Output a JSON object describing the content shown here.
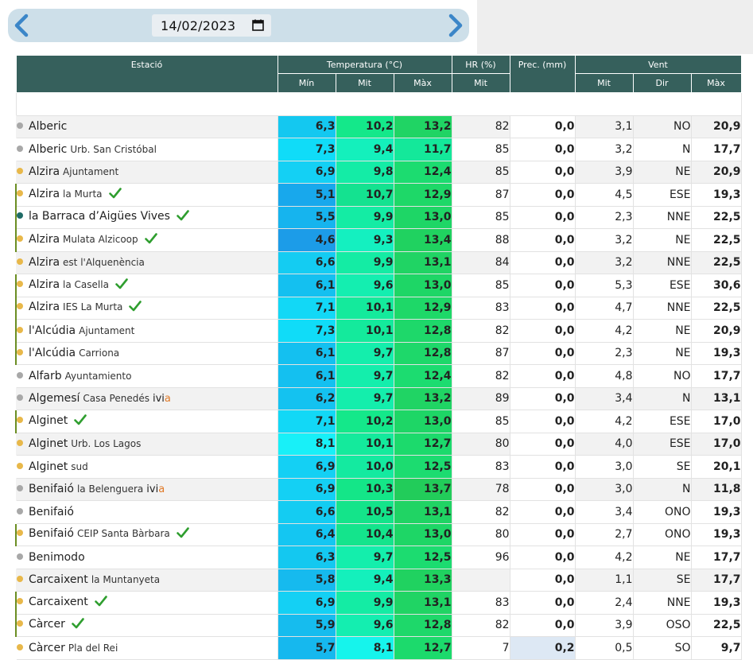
{
  "date": "14/02/2023",
  "colors": {
    "header_bg": "#36605c",
    "nav_bg": "#cddfe9",
    "arrow": "#3b86c8",
    "check": "#2f9e2f",
    "dot_colors": {
      "gray": "#a8a8a8",
      "yellow": "#e8b84a",
      "teal": "#1f6b66"
    },
    "left_bar": "#6b8e23"
  },
  "icons": {
    "prev": "chevron-left-icon",
    "next": "chevron-right-icon",
    "calendar": "calendar-icon",
    "check": "check-icon"
  },
  "headers": {
    "estacio": "Estació",
    "temperatura": "Temperatura (°C)",
    "hr": "HR (%)",
    "prec": "Prec. (mm)",
    "vent": "Vent",
    "min": "Mín",
    "mit": "Mit",
    "max": "Màx",
    "hr_mit": "Mit",
    "vent_mit": "Mit",
    "dir": "Dir",
    "vent_max": "Màx"
  },
  "rows": [
    {
      "name": "Alberic",
      "sub": "",
      "dot": "gray",
      "check": false,
      "ivia": false,
      "bar": false,
      "min": "6,3",
      "mit": "10,2",
      "max": "13,2",
      "hr": "82",
      "prec": "0,0",
      "vmit": "3,1",
      "dir": "NO",
      "vmax": "20,9",
      "minc": "#14c8f0",
      "mitc": "#14e88a",
      "maxc": "#20d464",
      "precc": "#ffffff"
    },
    {
      "name": "Alberic",
      "sub": "Urb. San Cristóbal",
      "dot": "gray",
      "check": false,
      "ivia": false,
      "bar": false,
      "min": "7,3",
      "mit": "9,4",
      "max": "11,7",
      "hr": "85",
      "prec": "0,0",
      "vmit": "3,2",
      "dir": "N",
      "vmax": "17,7",
      "minc": "#10dcf8",
      "mitc": "#14f0bc",
      "maxc": "#14e89a",
      "precc": "#ffffff"
    },
    {
      "name": "Alzira",
      "sub": "Ajuntament",
      "dot": "yellow",
      "check": false,
      "ivia": false,
      "bar": false,
      "min": "6,9",
      "mit": "9,8",
      "max": "12,4",
      "hr": "85",
      "prec": "0,0",
      "vmit": "3,9",
      "dir": "NE",
      "vmax": "20,9",
      "minc": "#14d0f4",
      "mitc": "#14eca6",
      "maxc": "#1cdc70",
      "precc": "#ffffff"
    },
    {
      "name": "Alzira",
      "sub": "la Murta",
      "dot": "yellow",
      "check": true,
      "ivia": false,
      "bar": true,
      "min": "5,1",
      "mit": "10,7",
      "max": "12,9",
      "hr": "87",
      "prec": "0,0",
      "vmit": "4,5",
      "dir": "ESE",
      "vmax": "19,3",
      "minc": "#18a8ec",
      "mitc": "#14e290",
      "maxc": "#1ed868",
      "precc": "#ffffff"
    },
    {
      "name": "la Barraca d’Aigües Vives",
      "sub": "",
      "dot": "teal",
      "check": true,
      "ivia": false,
      "bar": true,
      "min": "5,5",
      "mit": "9,9",
      "max": "13,0",
      "hr": "85",
      "prec": "0,0",
      "vmit": "2,3",
      "dir": "NNE",
      "vmax": "22,5",
      "minc": "#16b4ee",
      "mitc": "#14eca4",
      "maxc": "#1ed666",
      "precc": "#ffffff"
    },
    {
      "name": "Alzira",
      "sub": "Mulata Alzicoop",
      "dot": "yellow",
      "check": true,
      "ivia": false,
      "bar": true,
      "min": "4,6",
      "mit": "9,3",
      "max": "13,4",
      "hr": "88",
      "prec": "0,0",
      "vmit": "3,2",
      "dir": "NE",
      "vmax": "22,5",
      "minc": "#1c9ce8",
      "mitc": "#14f0c0",
      "maxc": "#20d260",
      "precc": "#ffffff"
    },
    {
      "name": "Alzira",
      "sub": "est l'Alquenència",
      "dot": "yellow",
      "check": false,
      "ivia": false,
      "bar": false,
      "min": "6,6",
      "mit": "9,9",
      "max": "13,1",
      "hr": "84",
      "prec": "0,0",
      "vmit": "3,2",
      "dir": "NNE",
      "vmax": "22,5",
      "minc": "#14ccf2",
      "mitc": "#14eca4",
      "maxc": "#20d464",
      "precc": "#ffffff"
    },
    {
      "name": "Alzira",
      "sub": "la Casella",
      "dot": "yellow",
      "check": true,
      "ivia": false,
      "bar": true,
      "min": "6,1",
      "mit": "9,6",
      "max": "13,0",
      "hr": "85",
      "prec": "0,0",
      "vmit": "5,3",
      "dir": "ESE",
      "vmax": "30,6",
      "minc": "#14c0f0",
      "mitc": "#14eeb0",
      "maxc": "#1ed666",
      "precc": "#ffffff"
    },
    {
      "name": "Alzira",
      "sub": "IES La Murta",
      "dot": "yellow",
      "check": true,
      "ivia": false,
      "bar": true,
      "min": "7,1",
      "mit": "10,1",
      "max": "12,9",
      "hr": "83",
      "prec": "0,0",
      "vmit": "4,7",
      "dir": "NNE",
      "vmax": "22,5",
      "minc": "#12d8f6",
      "mitc": "#14ea9c",
      "maxc": "#1ed868",
      "precc": "#ffffff"
    },
    {
      "name": "l'Alcúdia",
      "sub": "Ajuntament",
      "dot": "yellow",
      "check": false,
      "ivia": false,
      "bar": true,
      "min": "7,3",
      "mit": "10,1",
      "max": "12,8",
      "hr": "82",
      "prec": "0,0",
      "vmit": "4,2",
      "dir": "NE",
      "vmax": "20,9",
      "minc": "#10dcf8",
      "mitc": "#14ea9c",
      "maxc": "#1ed86a",
      "precc": "#ffffff"
    },
    {
      "name": "l'Alcúdia",
      "sub": "Carriona",
      "dot": "yellow",
      "check": false,
      "ivia": false,
      "bar": true,
      "min": "6,1",
      "mit": "9,7",
      "max": "12,8",
      "hr": "87",
      "prec": "0,0",
      "vmit": "2,3",
      "dir": "NE",
      "vmax": "19,3",
      "minc": "#14c0f0",
      "mitc": "#14eeac",
      "maxc": "#1ed86a",
      "precc": "#ffffff"
    },
    {
      "name": "Alfarb",
      "sub": "Ayuntamiento",
      "dot": "gray",
      "check": false,
      "ivia": false,
      "bar": false,
      "min": "6,1",
      "mit": "9,7",
      "max": "12,4",
      "hr": "82",
      "prec": "0,0",
      "vmit": "4,8",
      "dir": "NO",
      "vmax": "17,7",
      "minc": "#14c0f0",
      "mitc": "#14eeac",
      "maxc": "#1cdc70",
      "precc": "#ffffff"
    },
    {
      "name": "Algemesí",
      "sub": "Casa Penedés",
      "dot": "gray",
      "check": false,
      "ivia": true,
      "bar": false,
      "min": "6,2",
      "mit": "9,7",
      "max": "13,2",
      "hr": "89",
      "prec": "0,0",
      "vmit": "3,4",
      "dir": "N",
      "vmax": "13,1",
      "minc": "#14c2f0",
      "mitc": "#14eeac",
      "maxc": "#20d464",
      "precc": "#ffffff"
    },
    {
      "name": "Alginet",
      "sub": "",
      "dot": "yellow",
      "check": true,
      "ivia": false,
      "bar": true,
      "min": "7,1",
      "mit": "10,2",
      "max": "13,0",
      "hr": "85",
      "prec": "0,0",
      "vmit": "4,2",
      "dir": "ESE",
      "vmax": "17,0",
      "minc": "#12d8f6",
      "mitc": "#14e88a",
      "maxc": "#1ed666",
      "precc": "#ffffff"
    },
    {
      "name": "Alginet",
      "sub": "Urb. Los Lagos",
      "dot": "yellow",
      "check": false,
      "ivia": false,
      "bar": false,
      "min": "8,1",
      "mit": "10,1",
      "max": "12,7",
      "hr": "80",
      "prec": "0,0",
      "vmit": "4,0",
      "dir": "ESE",
      "vmax": "17,0",
      "minc": "#18f0f8",
      "mitc": "#14ea9c",
      "maxc": "#1cda6c",
      "precc": "#ffffff"
    },
    {
      "name": "Alginet",
      "sub": "sud",
      "dot": "yellow",
      "check": false,
      "ivia": false,
      "bar": false,
      "min": "6,9",
      "mit": "10,0",
      "max": "12,5",
      "hr": "83",
      "prec": "0,0",
      "vmit": "3,0",
      "dir": "SE",
      "vmax": "20,1",
      "minc": "#14d0f4",
      "mitc": "#14eaa0",
      "maxc": "#1cdc70",
      "precc": "#ffffff"
    },
    {
      "name": "Benifaió",
      "sub": "la Belenguera",
      "dot": "gray",
      "check": false,
      "ivia": true,
      "bar": false,
      "min": "6,9",
      "mit": "10,3",
      "max": "13,7",
      "hr": "78",
      "prec": "0,0",
      "vmit": "3,0",
      "dir": "N",
      "vmax": "11,8",
      "minc": "#14d0f4",
      "mitc": "#14e688",
      "maxc": "#22cc5a",
      "precc": "#ffffff"
    },
    {
      "name": "Benifaió",
      "sub": "",
      "dot": "gray",
      "check": false,
      "ivia": false,
      "bar": false,
      "min": "6,6",
      "mit": "10,5",
      "max": "13,1",
      "hr": "82",
      "prec": "0,0",
      "vmit": "3,4",
      "dir": "ONO",
      "vmax": "19,3",
      "minc": "#14ccf2",
      "mitc": "#14e48a",
      "maxc": "#20d464",
      "precc": "#ffffff"
    },
    {
      "name": "Benifaió",
      "sub": "CEIP Santa Bàrbara",
      "dot": "yellow",
      "check": true,
      "ivia": false,
      "bar": true,
      "min": "6,4",
      "mit": "10,4",
      "max": "13,0",
      "hr": "80",
      "prec": "0,0",
      "vmit": "2,7",
      "dir": "ONO",
      "vmax": "19,3",
      "minc": "#14c6f2",
      "mitc": "#14e48c",
      "maxc": "#1ed666",
      "precc": "#ffffff"
    },
    {
      "name": "Benimodo",
      "sub": "",
      "dot": "gray",
      "check": false,
      "ivia": false,
      "bar": false,
      "min": "6,3",
      "mit": "9,7",
      "max": "12,5",
      "hr": "96",
      "prec": "0,0",
      "vmit": "4,2",
      "dir": "NE",
      "vmax": "17,7",
      "minc": "#14c8f0",
      "mitc": "#14eeac",
      "maxc": "#1cdc70",
      "precc": "#ffffff"
    },
    {
      "name": "Carcaixent",
      "sub": "la Muntanyeta",
      "dot": "yellow",
      "check": false,
      "ivia": false,
      "bar": false,
      "min": "5,8",
      "mit": "9,4",
      "max": "13,3",
      "hr": "",
      "prec": "0,0",
      "vmit": "1,1",
      "dir": "SE",
      "vmax": "17,7",
      "minc": "#16baee",
      "mitc": "#14f0bc",
      "maxc": "#20d260",
      "precc": "#ffffff"
    },
    {
      "name": "Carcaixent",
      "sub": "",
      "dot": "yellow",
      "check": true,
      "ivia": false,
      "bar": true,
      "min": "6,9",
      "mit": "9,9",
      "max": "13,1",
      "hr": "83",
      "prec": "0,0",
      "vmit": "2,4",
      "dir": "NNE",
      "vmax": "19,3",
      "minc": "#14d0f4",
      "mitc": "#14eca4",
      "maxc": "#20d464",
      "precc": "#ffffff"
    },
    {
      "name": "Càrcer",
      "sub": "",
      "dot": "yellow",
      "check": true,
      "ivia": false,
      "bar": true,
      "min": "5,9",
      "mit": "9,6",
      "max": "12,8",
      "hr": "82",
      "prec": "0,0",
      "vmit": "3,9",
      "dir": "OSO",
      "vmax": "22,5",
      "minc": "#16bcee",
      "mitc": "#14eeb0",
      "maxc": "#1ed86a",
      "precc": "#ffffff"
    },
    {
      "name": "Càrcer",
      "sub": "Pla del Rei",
      "dot": "yellow",
      "check": false,
      "ivia": false,
      "bar": false,
      "min": "5,7",
      "mit": "8,1",
      "max": "12,7",
      "hr": "7",
      "prec": "0,2",
      "vmit": "0,5",
      "dir": "SO",
      "vmax": "9,7",
      "minc": "#16b8ee",
      "mitc": "#16f4ec",
      "maxc": "#1cda6c",
      "precc": "#dde8f4"
    }
  ]
}
